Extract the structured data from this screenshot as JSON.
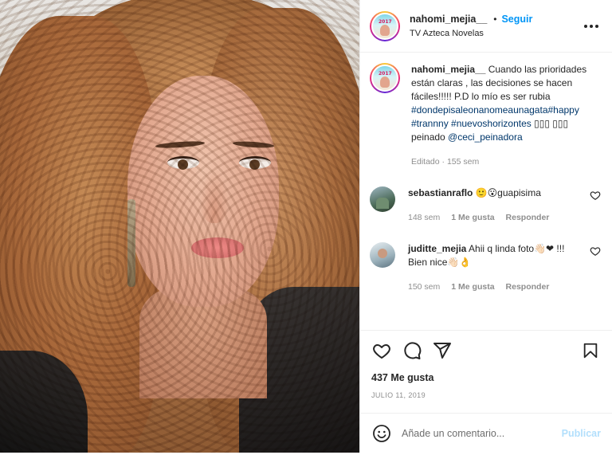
{
  "post": {
    "image_alt": "Selfie photo",
    "header": {
      "username": "nahomi_mejia__",
      "separator": "•",
      "follow_label": "Seguir",
      "location": "TV Azteca Novelas"
    },
    "avatar_tag": "2017",
    "caption": {
      "username": "nahomi_mejia__",
      "text": "Cuando las prioridades están claras , las decisiones se hacen fáciles!!!!! P.D lo mío es ser rubia",
      "hashtags": "#dondepisaleonanomeaunagata#happy #trannny #nuevoshorizontes",
      "trailing": " ▯▯▯ ▯▯▯ peinado ",
      "mention": "@ceci_peinadora",
      "meta": "Editado · 155 sem"
    },
    "comments": [
      {
        "username": "sebastianraflo",
        "text": "🙂😮guapisima",
        "time": "148 sem",
        "likes": "1 Me gusta",
        "reply": "Responder"
      },
      {
        "username": "juditte_mejia",
        "text": "Ahii q linda foto👋🏻❤ !!! Bien nice👋🏻👌",
        "time": "150 sem",
        "likes": "1 Me gusta",
        "reply": "Responder"
      }
    ],
    "likes_count": "437 Me gusta",
    "date": "JULIO 11, 2019",
    "add_comment": {
      "placeholder": "Añade un comentario...",
      "post_label": "Publicar"
    },
    "icons": {
      "like": "heart-icon",
      "comment": "comment-bubble-icon",
      "share": "paper-plane-icon",
      "save": "bookmark-icon",
      "emoji": "smiley-icon",
      "more": "more-options-icon"
    },
    "colors": {
      "link": "#0095f6",
      "hashtag": "#00376b",
      "muted": "#8e8e8e",
      "publish_disabled": "#b2dffc"
    }
  }
}
